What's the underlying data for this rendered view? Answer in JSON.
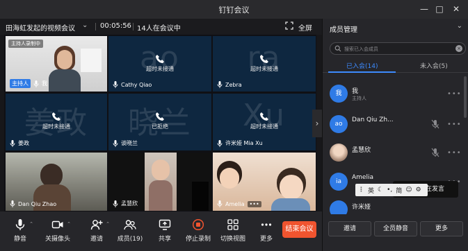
{
  "window": {
    "title": "钉钉会议"
  },
  "infobar": {
    "meeting_title": "田海虹发起的视频会议",
    "timer": "00:05:56",
    "participants_in_meeting": "14人在会议中",
    "fullscreen_label": "全屏"
  },
  "tiles": [
    {
      "name": "我",
      "host_badge": "主持人",
      "speaking": "主持人录制中",
      "type": "video"
    },
    {
      "name": "Cathy Qiao",
      "bigname": "ao",
      "status": "超时未接通",
      "type": "avatar"
    },
    {
      "name": "Zebra",
      "bigname": "ra",
      "status": "超时未接通",
      "type": "avatar"
    },
    {
      "name": "姜政",
      "bigname": "姜政",
      "status": "超时未接通",
      "type": "avatar"
    },
    {
      "name": "谈晓兰",
      "bigname": "晓兰",
      "status": "已拒绝",
      "type": "avatar"
    },
    {
      "name": "许米娅 Mia Xu",
      "bigname": "Xu",
      "status": "超时未接通",
      "type": "avatar"
    },
    {
      "name": "Dan Qiu Zhao",
      "type": "video"
    },
    {
      "name": "孟慧欣",
      "type": "video"
    },
    {
      "name": "Amelia",
      "type": "video"
    }
  ],
  "toolbar": {
    "mute": "静音",
    "camera": "关摄像头",
    "invite": "邀请",
    "members": "成员(19)",
    "share": "共享",
    "stop_record": "停止录制",
    "switch_view": "切换视图",
    "more": "更多",
    "end_meeting": "结束会议"
  },
  "panel": {
    "title": "成员管理",
    "search_placeholder": "搜索已入会成员",
    "tab_joined": "已入会(14)",
    "tab_not_joined": "未入会(5)",
    "members": [
      {
        "avatar_text": "我",
        "name": "我",
        "role": "主持人",
        "avatar_color": "#2f7be6"
      },
      {
        "avatar_text": "ao",
        "name": "Dan Qiu Zh...",
        "role": "",
        "avatar_color": "#2f7be6"
      },
      {
        "avatar_text": "",
        "name": "孟慧欣",
        "role": "",
        "avatar_color": "#d9c2b0"
      },
      {
        "avatar_text": "ia",
        "name": "Amelia",
        "role": "",
        "avatar_color": "#2f7be6"
      },
      {
        "avatar_text": "",
        "name": "许米娅",
        "role": "",
        "avatar_color": "#2f7be6"
      }
    ],
    "invite_button": "邀请",
    "mute_all_button": "全员静音",
    "more_button": "更多"
  },
  "ime": {
    "mode": "英",
    "simplified": "简"
  },
  "tooltip": {
    "text": "正在发言"
  },
  "colors": {
    "accent": "#3d8bff",
    "end_button": "#f0542f",
    "tile_bg": "#0e2740"
  }
}
